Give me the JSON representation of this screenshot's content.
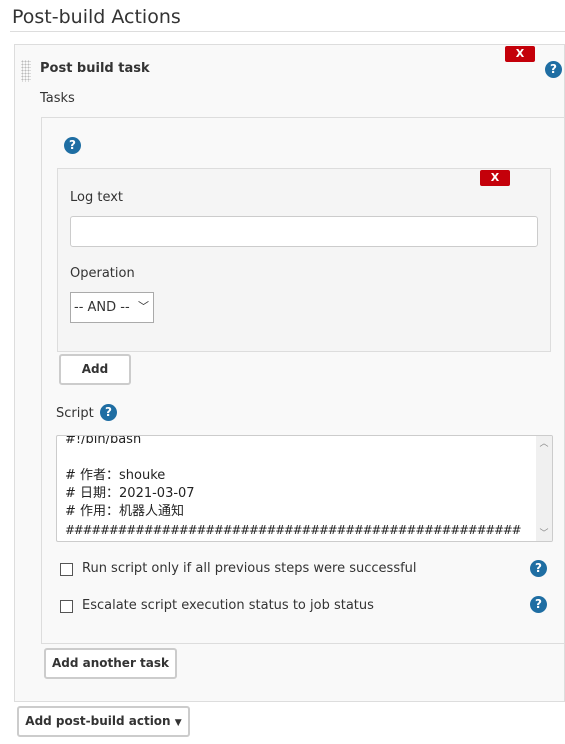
{
  "section_title": "Post-build Actions",
  "post_build_task": {
    "title": "Post build task",
    "delete_label": "X",
    "tasks_label": "Tasks"
  },
  "task": {
    "delete_label": "X",
    "log_text_label": "Log text",
    "log_text_value": "",
    "operation_label": "Operation",
    "operation_value": "-- AND --",
    "add_label": "Add",
    "script_label": "Script",
    "script_lines": [
      "#!/bin/bash",
      "",
      "# 作者：shouke",
      "# 日期：2021-03-07",
      "# 作用：机器人通知",
      "####################################################"
    ],
    "checkbox1": {
      "label": "Run script only if all previous steps were successful",
      "checked": false
    },
    "checkbox2": {
      "label": "Escalate script execution status to job status",
      "checked": false
    }
  },
  "add_another_task_label": "Add another task",
  "add_post_build_action_label": "Add post-build action",
  "help_glyph": "?",
  "colors": {
    "help": "#1f6ea3",
    "delete": "#c4000a"
  }
}
